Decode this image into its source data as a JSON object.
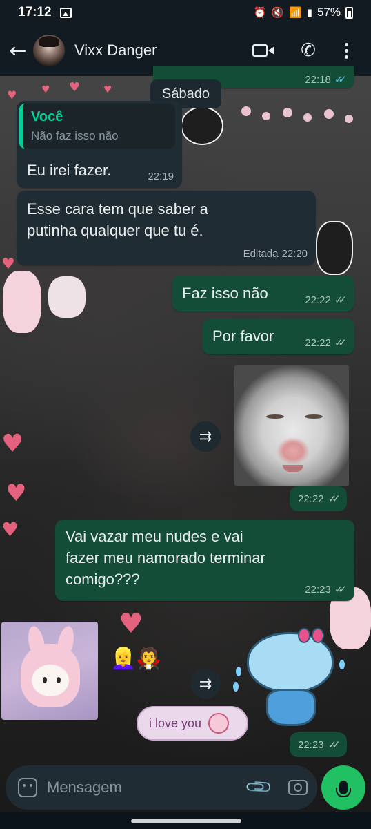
{
  "status_bar": {
    "time": "17:12",
    "battery": "57%",
    "icons": [
      "gallery-icon",
      "alarm-icon",
      "mute-icon",
      "wifi-icon",
      "volte-icon",
      "signal-icon",
      "battery-icon"
    ]
  },
  "header": {
    "contact_name": "Vixx Danger",
    "actions": [
      "video-call-icon",
      "voice-call-icon",
      "menu-icon"
    ]
  },
  "chat": {
    "top_partial_time": "22:18",
    "day_separator": "Sábado",
    "messages": [
      {
        "direction": "in",
        "quote_author": "Você",
        "quote_text": "Não faz isso não",
        "text": "Eu irei fazer.",
        "time": "22:19"
      },
      {
        "direction": "in",
        "text_line1": "Esse cara tem que saber a",
        "text_line2": "putinha qualquer que tu é.",
        "edited_label": "Editada",
        "time": "22:20"
      },
      {
        "direction": "out",
        "text": "Faz isso não",
        "time": "22:22",
        "status": "delivered"
      },
      {
        "direction": "out",
        "text": "Por favor",
        "time": "22:22",
        "status": "delivered"
      },
      {
        "direction": "out",
        "type": "image",
        "time": "22:22",
        "status": "delivered"
      },
      {
        "direction": "out",
        "text_line1": "Vai vazar meu nudes e vai",
        "text_line2": "fazer meu namorado terminar",
        "text_line3": "comigo???",
        "time": "22:23",
        "status": "delivered"
      },
      {
        "direction": "out",
        "type": "sticker",
        "sticker_text": "i love you",
        "time": "22:23",
        "status": "delivered"
      }
    ]
  },
  "input": {
    "placeholder": "Mensagem"
  },
  "colors": {
    "incoming_bubble": "#202c33",
    "outgoing_bubble": "#144d37",
    "accent": "#06cf9c",
    "mic_button": "#21c063",
    "read_ticks": "#53bdeb"
  }
}
